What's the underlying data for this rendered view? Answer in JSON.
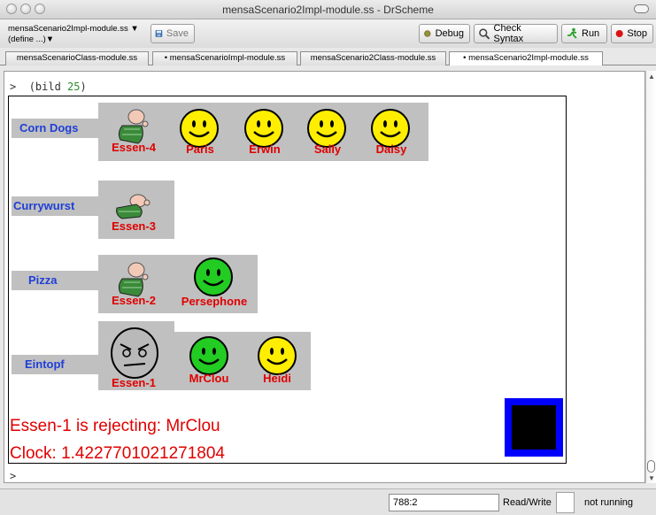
{
  "window": {
    "title": "mensaScenario2Impl-module.ss - DrScheme"
  },
  "toolbar": {
    "file_name": "mensaScenario2Impl-module.ss",
    "define_popup": "(define ...)",
    "save": "Save",
    "debug": "Debug",
    "check_syntax": "Check Syntax",
    "run": "Run",
    "stop": "Stop"
  },
  "tabs": [
    {
      "label": "mensaScenarioClass-module.ss",
      "active": false
    },
    {
      "label": "• mensaScenarioImpl-module.ss",
      "active": false
    },
    {
      "label": "mensaScenario2Class-module.ss",
      "active": false
    },
    {
      "label": "• mensaScenario2Impl-module.ss",
      "active": true
    }
  ],
  "repl": {
    "prompt": ">",
    "call_open": "(bild ",
    "call_arg": "25",
    "call_close": ")",
    "next_prompt": ">"
  },
  "simulation": {
    "rows": [
      {
        "food": "Corn Dogs",
        "server": "Essen-4",
        "server_icon": "cook-icon",
        "queue": [
          {
            "name": "Paris",
            "face": "yellow"
          },
          {
            "name": "Erwin",
            "face": "yellow"
          },
          {
            "name": "Sally",
            "face": "yellow"
          },
          {
            "name": "Daisy",
            "face": "yellow"
          }
        ]
      },
      {
        "food": "Currywurst",
        "server": "Essen-3",
        "server_icon": "cook-icon",
        "queue": []
      },
      {
        "food": "Pizza",
        "server": "Essen-2",
        "server_icon": "cook-icon",
        "queue": [
          {
            "name": "Persephone",
            "face": "green"
          }
        ]
      },
      {
        "food": "Eintopf",
        "server": "Essen-1",
        "server_icon": "angry-face-icon",
        "queue": [
          {
            "name": "MrClou",
            "face": "green"
          },
          {
            "name": "Heidi",
            "face": "yellow"
          }
        ]
      }
    ],
    "message": "Essen-1 is rejecting: MrClou",
    "clock": "Clock: 1.4227701021271804",
    "colors": {
      "yellow_face": "#ffee00",
      "green_face": "#22cc22",
      "label_red": "#e00000",
      "label_blue": "#1f3fd6",
      "box_blue": "#0000ff"
    }
  },
  "status": {
    "position": "788:2",
    "read_write": "Read/Write",
    "running": "not running"
  }
}
